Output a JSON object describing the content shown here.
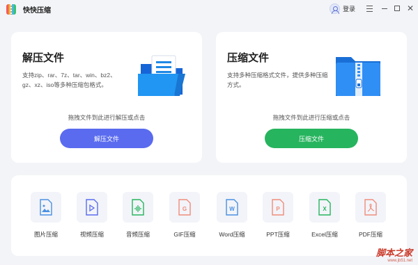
{
  "app": {
    "title": "快快压缩",
    "login_label": "登录"
  },
  "extract_card": {
    "title": "解压文件",
    "description": "支持zip、rar、7z、tar、win、bz2、gz、xz、iso等多种压缩包格式。",
    "drop_hint": "拖拽文件到此进行解压或点击",
    "button_label": "解压文件",
    "button_color": "#5a6bef"
  },
  "compress_card": {
    "title": "压缩文件",
    "description": "支持多种压缩格式文件，提供多种压缩方式。",
    "drop_hint": "拖拽文件到此进行压缩或点击",
    "button_label": "压缩文件",
    "button_color": "#27b45e"
  },
  "tools": [
    {
      "label": "图片压缩",
      "icon": "image-file-icon",
      "color": "#4a90e2"
    },
    {
      "label": "视频压缩",
      "icon": "video-file-icon",
      "color": "#5a6bef"
    },
    {
      "label": "音频压缩",
      "icon": "audio-file-icon",
      "color": "#27b45e"
    },
    {
      "label": "GIF压缩",
      "icon": "gif-file-icon",
      "color": "#f08c7a"
    },
    {
      "label": "Word压缩",
      "icon": "word-file-icon",
      "color": "#4a90e2"
    },
    {
      "label": "PPT压缩",
      "icon": "ppt-file-icon",
      "color": "#f08c7a"
    },
    {
      "label": "Excel压缩",
      "icon": "excel-file-icon",
      "color": "#27b45e"
    },
    {
      "label": "PDF压缩",
      "icon": "pdf-file-icon",
      "color": "#f08c7a"
    }
  ],
  "watermark": {
    "main": "脚本之家",
    "sub": "www.jb51.net"
  }
}
